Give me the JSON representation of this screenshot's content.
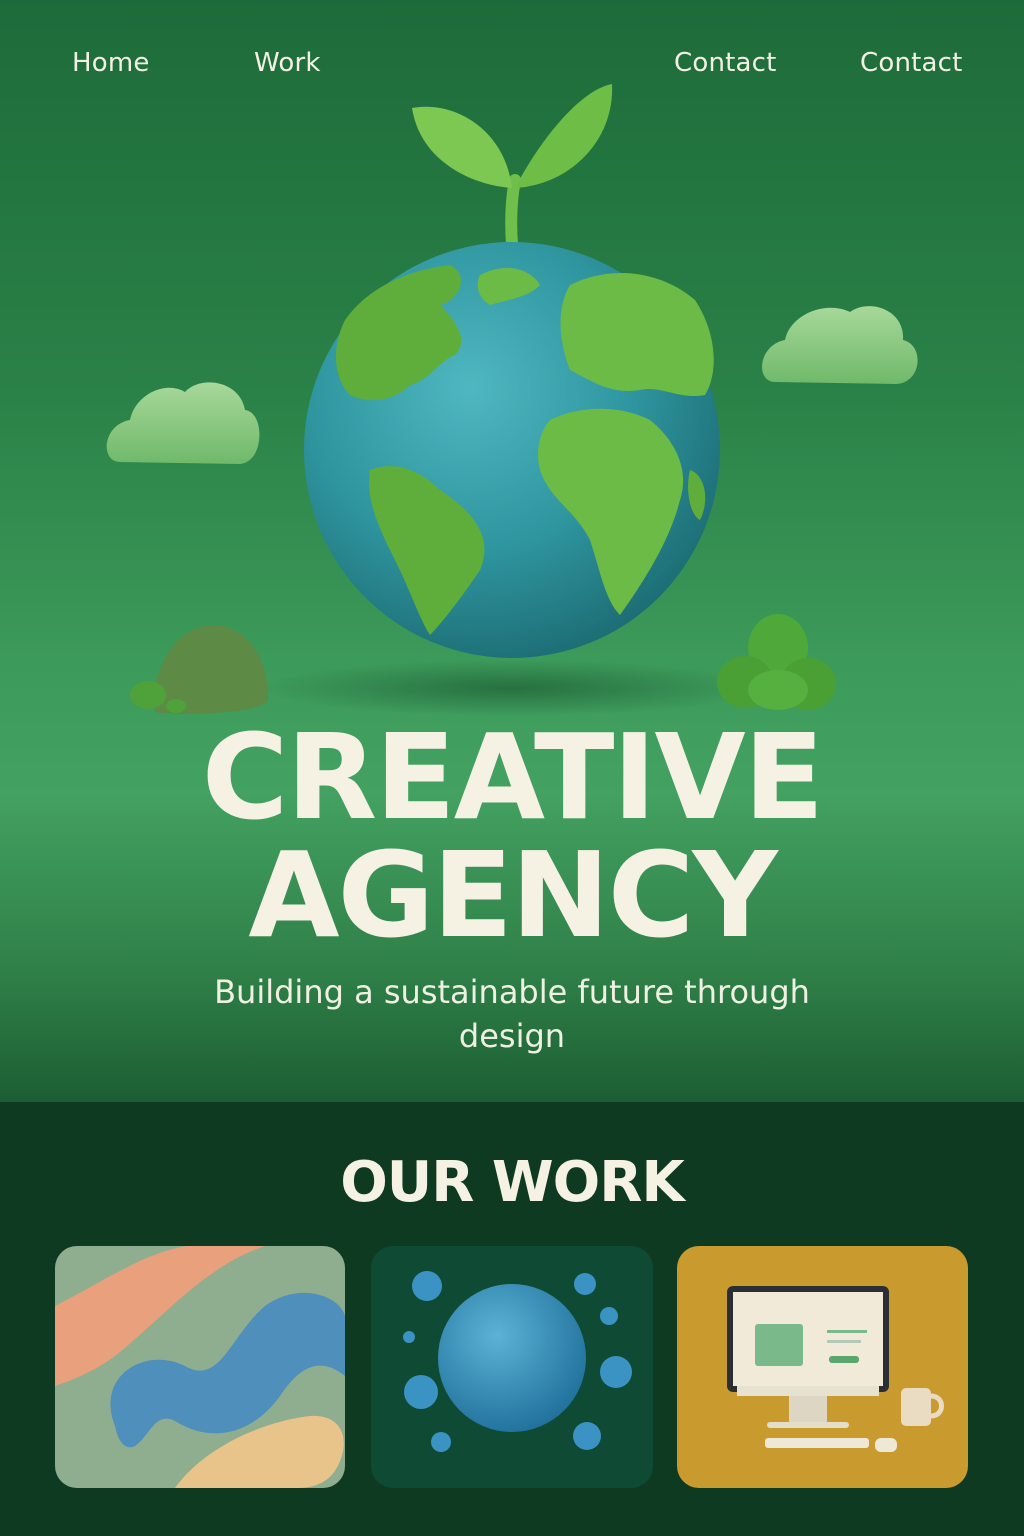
{
  "nav": {
    "items": [
      {
        "label": "Home"
      },
      {
        "label": "Work"
      },
      {
        "label": "Contact"
      },
      {
        "label": "Contact"
      }
    ]
  },
  "hero": {
    "title_line1": "CREATIVE",
    "title_line2": "AGENCY",
    "subtitle": "Building a sustainable future through design"
  },
  "work": {
    "title": "OUR WORK",
    "cards": [
      {
        "icon": "abstract-shapes"
      },
      {
        "icon": "sphere-bubbles"
      },
      {
        "icon": "desktop-computer"
      }
    ]
  },
  "colors": {
    "hero_green": "#2a8147",
    "dark_green": "#0f3a22",
    "cream_text": "#f5f1e3"
  }
}
